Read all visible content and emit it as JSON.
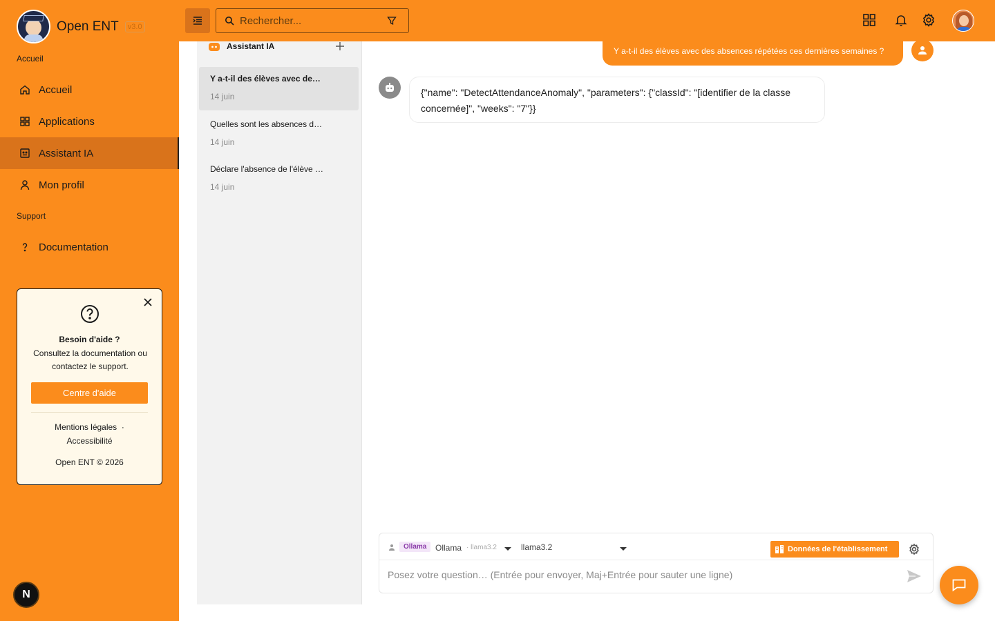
{
  "app": {
    "name": "Open ENT",
    "version": "v3.0"
  },
  "sidebar": {
    "section_main": "Accueil",
    "section_support": "Support",
    "items": [
      {
        "label": "Accueil",
        "icon": "home-icon"
      },
      {
        "label": "Applications",
        "icon": "grid-icon"
      },
      {
        "label": "Assistant IA",
        "icon": "assistant-icon",
        "active": true
      },
      {
        "label": "Mon profil",
        "icon": "user-icon"
      },
      {
        "label": "Documentation",
        "icon": "question-icon"
      }
    ]
  },
  "help_card": {
    "title": "Besoin d'aide ?",
    "text": "Consultez la documentation ou contactez le support.",
    "button": "Centre d'aide",
    "link_legal": "Mentions légales",
    "link_separator": "·",
    "link_access": "Accessibilité",
    "footer": "Open ENT © 2026"
  },
  "badge": {
    "letter": "N"
  },
  "topbar": {
    "search_placeholder": "Rechercher...",
    "icons": [
      "menu-icon",
      "search-icon",
      "filter-icon",
      "apps-grid-icon",
      "bell-icon",
      "gear-icon",
      "avatar"
    ]
  },
  "conversations": {
    "title": "Assistant IA",
    "items": [
      {
        "title": "Y a-t-il des élèves avec des absences répétées ces dernières semaines ?",
        "date": "14 juin",
        "active": true
      },
      {
        "title": "Quelles sont les absences de la semaine ?",
        "date": "14 juin"
      },
      {
        "title": "Déclare l'absence de l'élève demain",
        "date": "14 juin"
      }
    ]
  },
  "chat": {
    "user_message": "Y a-t-il des élèves avec des absences répétées ces dernières semaines ?",
    "bot_message": "{\"name\": \"DetectAttendanceAnomaly\", \"parameters\": {\"classId\": \"[identifier de la classe concernée]\", \"weeks\": \"7\"}}"
  },
  "composer": {
    "provider_tag": "Ollama",
    "provider_name": "Ollama",
    "provider_model": "· llama3.2",
    "model_select": "llama3.2",
    "data_button": "Données de l'établissement",
    "placeholder": "Posez votre question… (Entrée pour envoyer, Maj+Entrée pour sauter une ligne)"
  },
  "colors": {
    "accent": "#fb8c1c",
    "accent_dark": "#d9731b",
    "card_bg": "#fff9ea"
  }
}
